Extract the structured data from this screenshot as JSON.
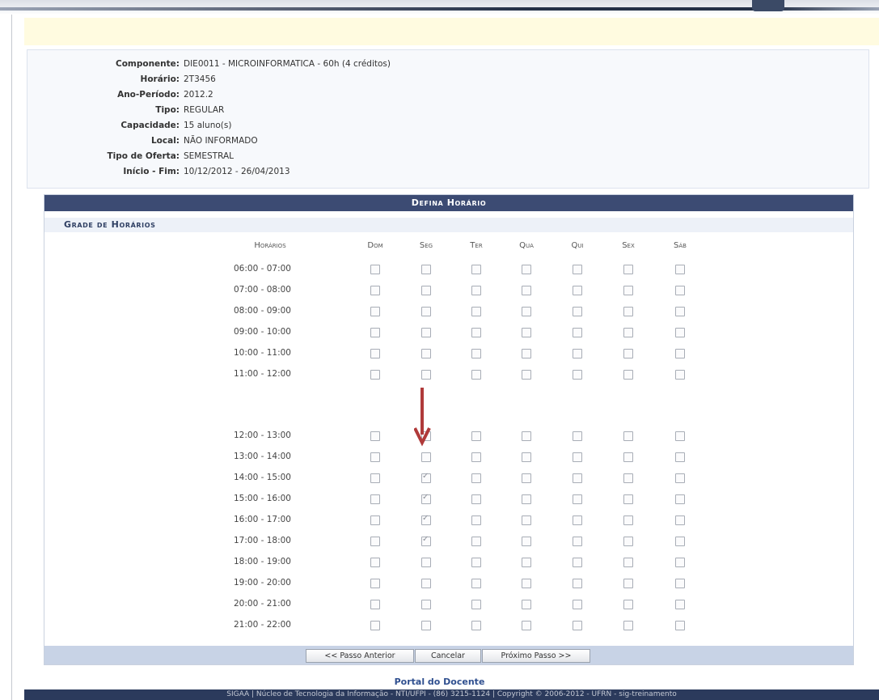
{
  "info": [
    {
      "label": "Componente:",
      "value": "DIE0011 - MICROINFORMATICA - 60h (4 créditos)"
    },
    {
      "label": "Horário:",
      "value": "2T3456"
    },
    {
      "label": "Ano-Período:",
      "value": "2012.2"
    },
    {
      "label": "Tipo:",
      "value": "REGULAR"
    },
    {
      "label": "Capacidade:",
      "value": "15 aluno(s)"
    },
    {
      "label": "Local:",
      "value": "NÃO INFORMADO"
    },
    {
      "label": "Tipo de Oferta:",
      "value": "SEMESTRAL"
    },
    {
      "label": "Início - Fim:",
      "value": "10/12/2012 - 26/04/2013"
    }
  ],
  "panel": {
    "title": "Defina Horário",
    "subtitle": "Grade de Horários",
    "col_time": "Horários",
    "days": [
      "Dom",
      "Seg",
      "Ter",
      "Qua",
      "Qui",
      "Sex",
      "Sáb"
    ]
  },
  "groups": [
    [
      "06:00 - 07:00",
      "07:00 - 08:00",
      "08:00 - 09:00",
      "09:00 - 10:00",
      "10:00 - 11:00",
      "11:00 - 12:00"
    ],
    [
      "12:00 - 13:00",
      "13:00 - 14:00",
      "14:00 - 15:00",
      "15:00 - 16:00",
      "16:00 - 17:00",
      "17:00 - 18:00"
    ],
    [
      "18:00 - 19:00",
      "19:00 - 20:00",
      "20:00 - 21:00",
      "21:00 - 22:00"
    ]
  ],
  "checked": [
    "14:00 - 15:00|Seg",
    "15:00 - 16:00|Seg",
    "16:00 - 17:00|Seg",
    "17:00 - 18:00|Seg"
  ],
  "buttons": {
    "prev": "<< Passo Anterior",
    "cancel": "Cancelar",
    "next": "Próximo Passo >>"
  },
  "portal": "Portal do Docente",
  "footer_text": "SIGAA | Núcleo de Tecnologia da Informação - NTI/UFPI - (86) 3215-1124 | Copyright © 2006-2012 - UFRN - sig-treinamento",
  "colors": {
    "header": "#3c4b73",
    "arrow": "#b03a3a"
  }
}
